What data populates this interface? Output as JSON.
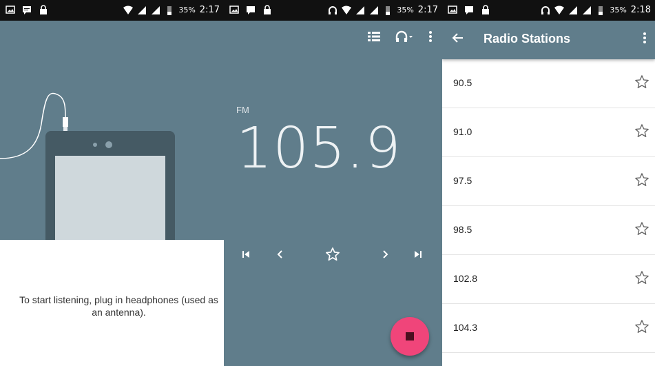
{
  "panels": [
    {
      "status": {
        "battery": "35%",
        "time": "2:17"
      },
      "message": "To start listening, plug in headphones (used as an antenna)."
    },
    {
      "status": {
        "battery": "35%",
        "time": "2:17"
      },
      "band": "FM",
      "frequency": "105.9",
      "toolbar_icons": [
        "list-icon",
        "headphones-icon",
        "more-vert-icon"
      ],
      "controls": [
        "skip-previous-icon",
        "chevron-left-icon",
        "star-outline-icon",
        "chevron-right-icon",
        "skip-next-icon"
      ],
      "fab_icon": "stop-icon"
    },
    {
      "status": {
        "battery": "35%",
        "time": "2:18"
      },
      "title": "Radio Stations",
      "stations": [
        "90.5",
        "91.0",
        "97.5",
        "98.5",
        "102.8",
        "104.3"
      ]
    }
  ],
  "colors": {
    "primary": "#607d8b",
    "fab": "#f0457a",
    "statusbar": "#111111"
  }
}
